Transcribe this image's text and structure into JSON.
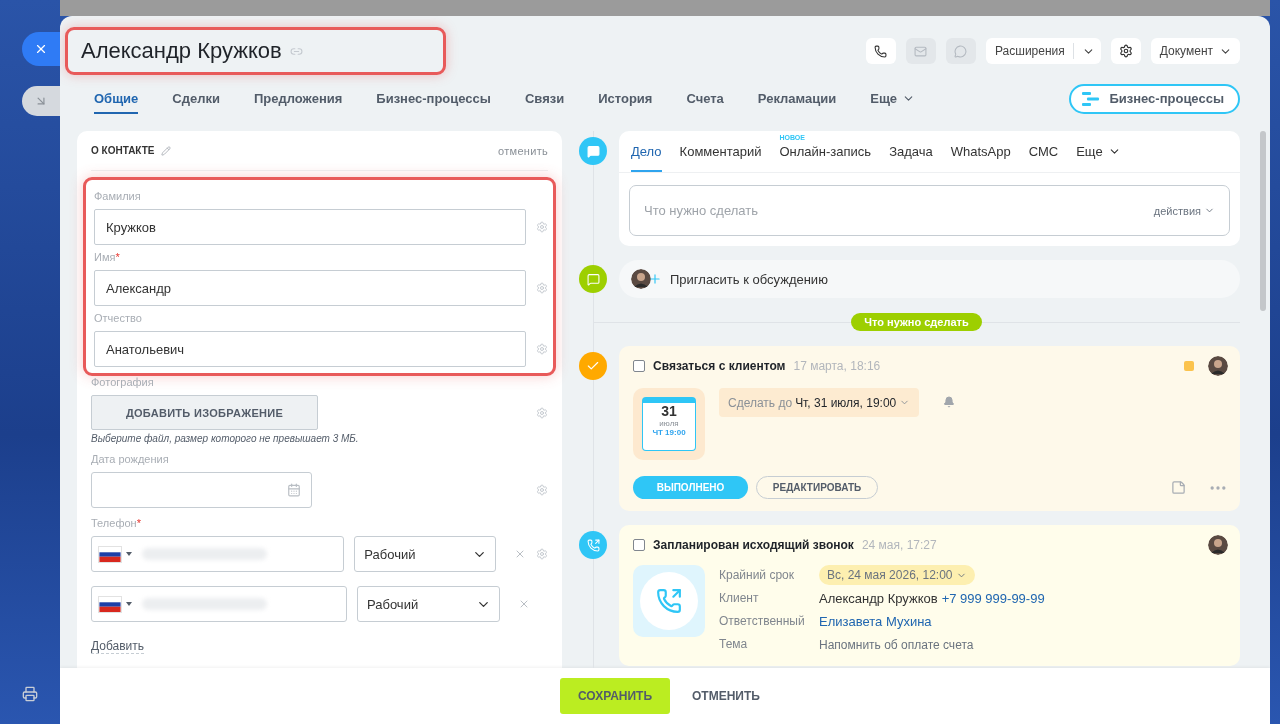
{
  "header": {
    "title": "Александр Кружков",
    "highlighted": true,
    "toolbar": {
      "buttons": [
        {
          "disabled": false
        },
        {
          "disabled": true
        },
        {
          "disabled": true
        }
      ],
      "extensions": "Расширения",
      "document": "Документ"
    }
  },
  "tabs": [
    {
      "label": "Общие",
      "selected": true,
      "kind": "tab"
    },
    {
      "label": "Сделки",
      "selected": false,
      "kind": "tab"
    },
    {
      "label": "Предложения",
      "selected": false,
      "kind": "tab"
    },
    {
      "label": "Бизнес-процессы",
      "selected": false,
      "kind": "tab"
    },
    {
      "label": "Связи",
      "selected": false,
      "kind": "tab"
    },
    {
      "label": "История",
      "selected": false,
      "kind": "tab"
    },
    {
      "label": "Счета",
      "selected": false,
      "kind": "tab"
    },
    {
      "label": "Рекламации",
      "selected": false,
      "kind": "tab"
    },
    {
      "label": "Еще",
      "selected": false,
      "kind": "more"
    }
  ],
  "process_button": "Бизнес-процессы",
  "contact": {
    "title": "О КОНТАКТЕ",
    "cancel": "отменить",
    "highlighted": true,
    "required_mark": "*",
    "name_fields": [
      {
        "label": "Фамилия",
        "value": "Кружков",
        "required": false
      },
      {
        "label": "Имя",
        "value": "Александр",
        "required": true
      },
      {
        "label": "Отчество",
        "value": "Анатольевич",
        "required": false
      }
    ],
    "photo": {
      "label": "Фотография",
      "button": "ДОБАВИТЬ ИЗОБРАЖЕНИЕ",
      "hint": "Выберите файл, размер которого не превышает 3 МБ."
    },
    "birthday": {
      "label": "Дата рождения",
      "required": false
    },
    "phone": {
      "label": "Телефон",
      "required": true,
      "rows": [
        {
          "type": "Рабочий",
          "settings": true
        },
        {
          "type": "Рабочий",
          "settings": false
        }
      ]
    },
    "add": "Добавить"
  },
  "composer": {
    "tabs": [
      {
        "label": "Дело",
        "selected": true,
        "kind": "tab"
      },
      {
        "label": "Комментарий",
        "selected": false,
        "kind": "tab"
      },
      {
        "label": "Онлайн-запись",
        "selected": false,
        "kind": "tab",
        "badge": "НОВОЕ"
      },
      {
        "label": "Задача",
        "selected": false,
        "kind": "tab"
      },
      {
        "label": "WhatsApp",
        "selected": false,
        "kind": "tab"
      },
      {
        "label": "СМС",
        "selected": false,
        "kind": "tab"
      },
      {
        "label": "Еще",
        "selected": false,
        "kind": "more"
      }
    ],
    "placeholder": "Что нужно сделать",
    "actions": "действия"
  },
  "invite": "Пригласить к обсуждению",
  "divider_label": "Что нужно сделать",
  "activities": [
    {
      "kind": "task",
      "checked": false,
      "title": "Связаться с клиентом",
      "time": "17 марта, 18:16",
      "calendar": {
        "day": "31",
        "month": "июля",
        "time": "ЧТ 19:00"
      },
      "deadline_label": "Сделать до",
      "deadline": "Чт, 31 июля, 19:00",
      "done": "ВЫПОЛНЕНО",
      "edit": "РЕДАКТИРОВАТЬ"
    },
    {
      "kind": "call",
      "checked": false,
      "title": "Запланирован исходящий звонок",
      "time": "24 мая, 17:27",
      "details": [
        {
          "kind": "badge",
          "label": "Крайний срок",
          "value": "Вс, 24 мая 2026, 12:00"
        },
        {
          "kind": "contact",
          "label": "Клиент",
          "value": "Александр Кружков",
          "link": "+7 999 999-99-99"
        },
        {
          "kind": "link",
          "label": "Ответственный",
          "value": "Елизавета Мухина"
        },
        {
          "kind": "plain",
          "label": "Тема",
          "value": "Напомнить об оплате счета"
        }
      ]
    }
  ],
  "footer": {
    "save": "СОХРАНИТЬ",
    "cancel": "ОТМЕНИТЬ"
  }
}
